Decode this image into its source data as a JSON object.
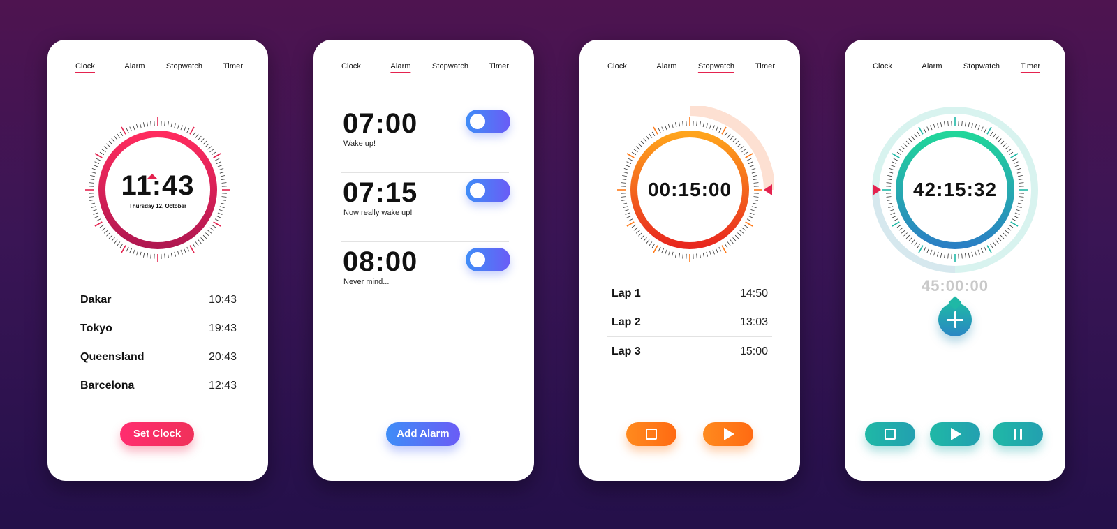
{
  "colors": {
    "background_top": "#4e1450",
    "background_bottom": "#24104a",
    "tab_underline": "#e4234f",
    "clock_accent": "#e4234f",
    "alarm_accent": "#4f7cf7",
    "stopwatch_accent": "#ff7a18",
    "timer_accent": "#1fb8a6"
  },
  "tabs": [
    "Clock",
    "Alarm",
    "Stopwatch",
    "Timer"
  ],
  "clock_screen": {
    "active_tab": "Clock",
    "time": "11:43",
    "date": "Thursday 12, October",
    "cities": [
      {
        "name": "Dakar",
        "time": "10:43"
      },
      {
        "name": "Tokyo",
        "time": "19:43"
      },
      {
        "name": "Queensland",
        "time": "20:43"
      },
      {
        "name": "Barcelona",
        "time": "12:43"
      }
    ],
    "button_label": "Set Clock"
  },
  "alarm_screen": {
    "active_tab": "Alarm",
    "alarms": [
      {
        "time": "07:00",
        "label": "Wake up!",
        "enabled": true
      },
      {
        "time": "07:15",
        "label": "Now really wake up!",
        "enabled": true
      },
      {
        "time": "08:00",
        "label": "Never mind...",
        "enabled": true
      }
    ],
    "button_label": "Add Alarm"
  },
  "stopwatch_screen": {
    "active_tab": "Stopwatch",
    "elapsed": "00:15:00",
    "laps": [
      {
        "name": "Lap 1",
        "time": "14:50"
      },
      {
        "name": "Lap 2",
        "time": "13:03"
      },
      {
        "name": "Lap 3",
        "time": "15:00"
      }
    ],
    "controls": {
      "stop_icon": "stop-icon",
      "play_icon": "play-icon"
    }
  },
  "timer_screen": {
    "active_tab": "Timer",
    "remaining": "42:15:32",
    "total": "45:00:00",
    "add_icon": "plus-icon",
    "controls": {
      "stop_icon": "stop-icon",
      "play_icon": "play-icon",
      "pause_icon": "pause-icon"
    }
  }
}
